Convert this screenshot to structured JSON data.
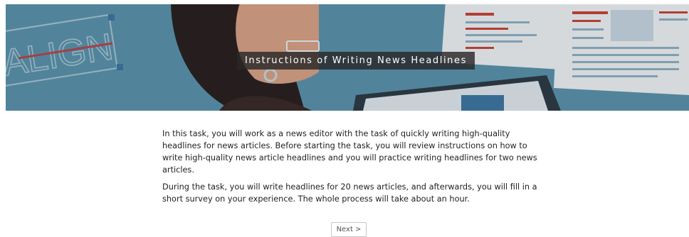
{
  "banner": {
    "title": "Instructions of Writing News Headlines",
    "sign_text": "ALIGN"
  },
  "content": {
    "paragraph_1": "In this task, you will work as a news editor with the task of quickly writing high-quality headlines for news articles. Before starting the task, you will review instructions on how to write high-quality news article headlines and you will practice writing headlines for two news articles.",
    "paragraph_2": "During the task, you will write headlines for 20 news articles, and afterwards, you will fill in a short survey on your experience. The whole process will take about an hour."
  },
  "navigation": {
    "next_label": "Next >"
  },
  "colors": {
    "banner_background": "#5b93ad",
    "title_background": "#282828",
    "accent_red": "#c8463c",
    "text": "#1f1f1f"
  }
}
